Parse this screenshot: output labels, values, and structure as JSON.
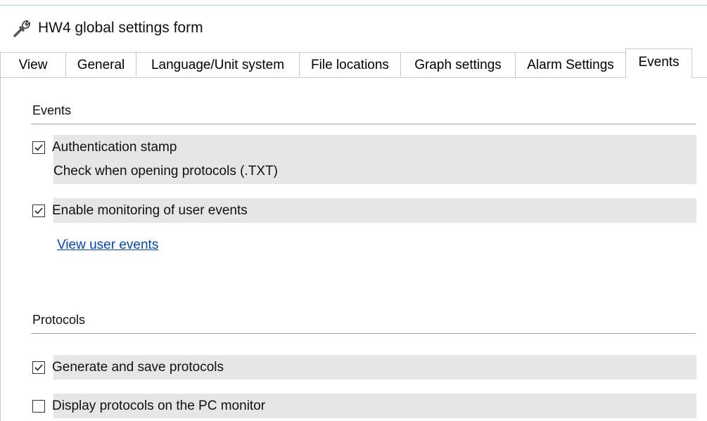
{
  "window": {
    "title": "HW4 global settings form",
    "icon": "wrench-icon"
  },
  "tabs": [
    {
      "label": "View"
    },
    {
      "label": "General"
    },
    {
      "label": "Language/Unit system"
    },
    {
      "label": "File locations"
    },
    {
      "label": "Graph settings"
    },
    {
      "label": "Alarm Settings"
    },
    {
      "label": "Events",
      "active": true
    }
  ],
  "sections": {
    "events": {
      "title": "Events",
      "authentication": {
        "label": "Authentication stamp",
        "sublabel": "Check when opening protocols (.TXT)",
        "checked": true
      },
      "monitoring": {
        "label": "Enable monitoring of user events",
        "checked": true
      },
      "view_link": "View user events"
    },
    "protocols": {
      "title": "Protocols",
      "generate": {
        "label": "Generate and save protocols",
        "checked": true
      },
      "display": {
        "label": "Display protocols on the PC monitor",
        "checked": false
      }
    }
  }
}
